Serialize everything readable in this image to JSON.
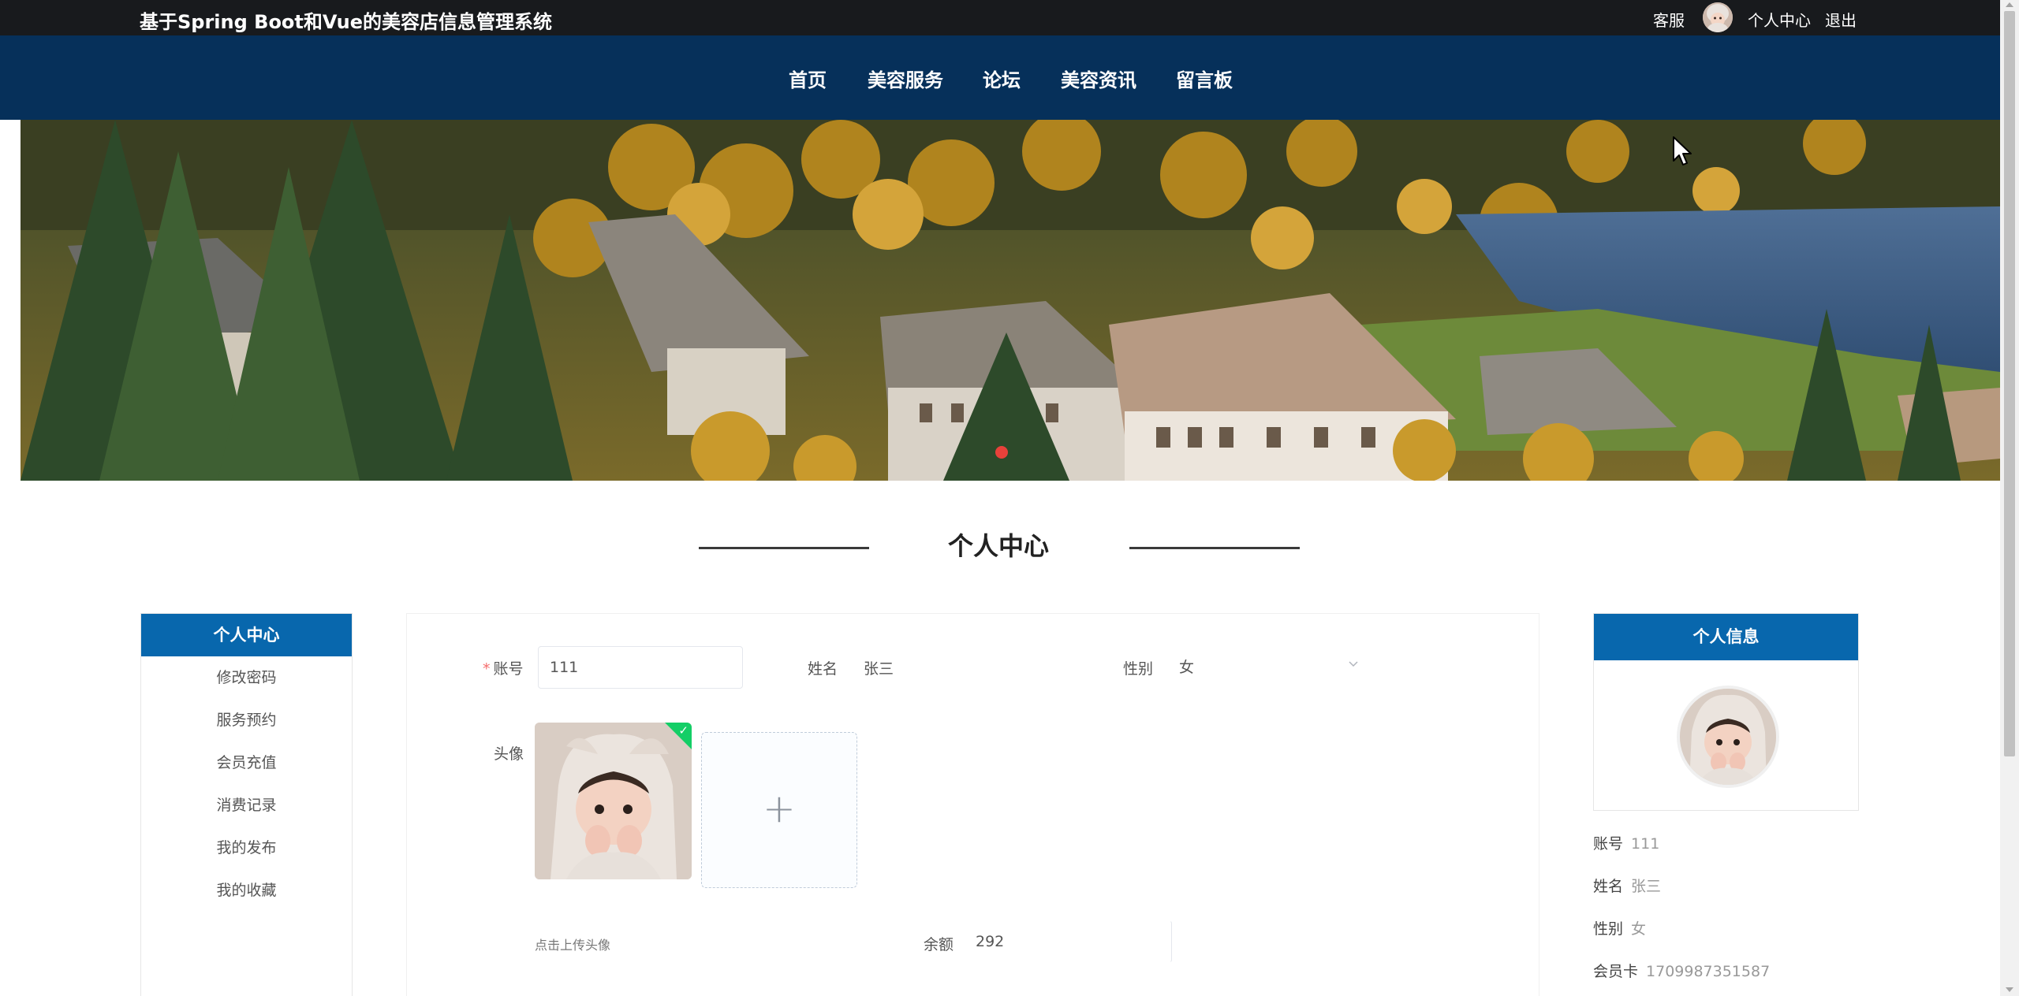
{
  "header": {
    "site_title": "基于Spring Boot和Vue的美容店信息管理系统",
    "links": {
      "customer_service": "客服",
      "user_center": "个人中心",
      "logout": "退出"
    }
  },
  "nav": {
    "items": [
      "首页",
      "美容服务",
      "论坛",
      "美容资讯",
      "留言板"
    ]
  },
  "page": {
    "heading": "个人中心"
  },
  "sidebar": {
    "title": "个人中心",
    "items": [
      "修改密码",
      "服务预约",
      "会员充值",
      "消费记录",
      "我的发布",
      "我的收藏"
    ]
  },
  "form": {
    "account_label": "账号",
    "required_mark": "*",
    "account_value": "111",
    "name_label": "姓名",
    "name_value": "张三",
    "gender_label": "性别",
    "gender_value": "女",
    "avatar_label": "头像",
    "upload_tip": "点击上传头像",
    "balance_label": "余额",
    "balance_value": "292",
    "upload_plus": "+"
  },
  "info_card": {
    "title": "个人信息",
    "account_label": "账号",
    "account_value": "111",
    "name_label": "姓名",
    "name_value": "张三",
    "gender_label": "性别",
    "gender_value": "女",
    "card_label": "会员卡",
    "card_value": "1709987351587"
  },
  "colors": {
    "topbar": "#181a1d",
    "navbar": "#06305a",
    "accent_blue": "#0867ad",
    "carousel_dot": "#e8413a",
    "upload_success": "#13ce66"
  },
  "icons": {
    "upload_success": "check-icon",
    "upload_add": "plus-icon",
    "select_arrow": "chevron-down-icon"
  }
}
